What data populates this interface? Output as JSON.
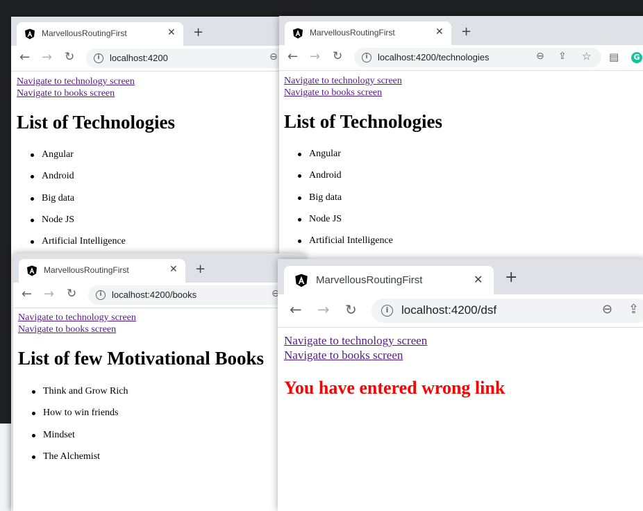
{
  "tab_title": "MarvellousRoutingFirst",
  "icons": {
    "favicon": "angular-icon",
    "close": "close-icon",
    "new_tab": "plus-icon",
    "back": "back-arrow-icon",
    "forward": "forward-arrow-icon",
    "reload": "reload-icon",
    "info": "site-info-icon",
    "zoom": "zoom-out-icon",
    "share": "share-icon",
    "star": "bookmark-star-icon",
    "reader": "reading-list-icon",
    "grammarly": "grammarly-icon"
  },
  "colors": {
    "link": "#551a8b",
    "error": "#ff0000",
    "tabbar": "#dee1e6",
    "omnibox": "#f1f3f4",
    "grammarly": "#15c39a"
  },
  "links": {
    "technology": "Navigate to technology screen",
    "books": "Navigate to books screen"
  },
  "windows": {
    "home": {
      "url": "localhost:4200",
      "heading": "List of Technologies",
      "items": [
        "Angular",
        "Android",
        "Big data",
        "Node JS",
        "Artificial Intelligence"
      ]
    },
    "technologies": {
      "url": "localhost:4200/technologies",
      "heading": "List of Technologies",
      "items": [
        "Angular",
        "Android",
        "Big data",
        "Node JS",
        "Artificial Intelligence"
      ]
    },
    "books": {
      "url": "localhost:4200/books",
      "heading": "List of few Motivational Books",
      "items": [
        "Think and Grow Rich",
        "How to win friends",
        "Mindset",
        "The Alchemist"
      ]
    },
    "wrong": {
      "url": "localhost:4200/dsf",
      "error_text": "You have entered wrong link"
    }
  }
}
